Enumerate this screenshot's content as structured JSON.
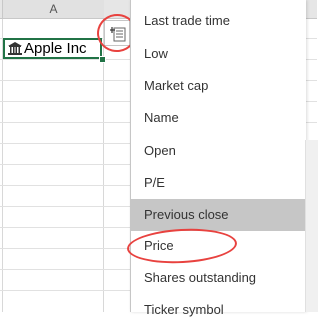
{
  "sheet": {
    "column_header": "A",
    "cell_value": "Apple Inc"
  },
  "icons": {
    "cell": "bank-icon",
    "insert_data": "insert-data-icon"
  },
  "menu": {
    "items": [
      {
        "label": "Last trade time"
      },
      {
        "label": "Low"
      },
      {
        "label": "Market cap"
      },
      {
        "label": "Name"
      },
      {
        "label": "Open"
      },
      {
        "label": "P/E"
      },
      {
        "label": "Previous close",
        "highlighted": true
      },
      {
        "label": "Price"
      },
      {
        "label": "Shares outstanding"
      },
      {
        "label": "Ticker symbol"
      }
    ]
  },
  "colors": {
    "selection": "#217346",
    "annotation": "#e8423f",
    "highlight": "#c6c6c6"
  }
}
